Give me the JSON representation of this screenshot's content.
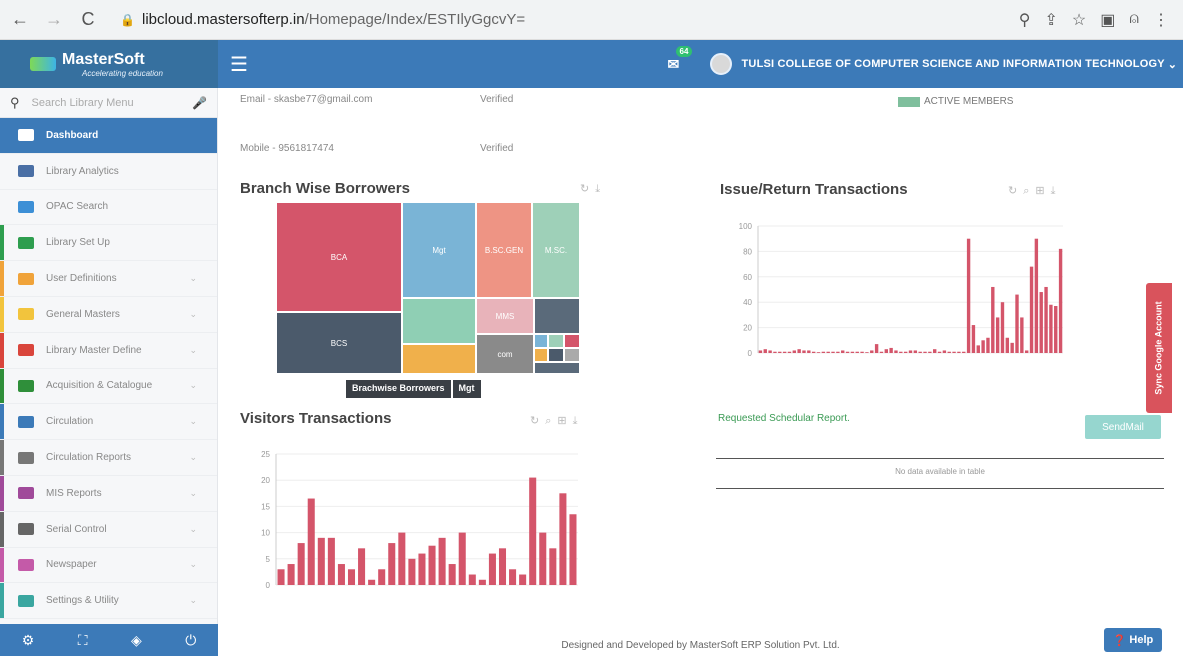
{
  "browser": {
    "url_host": "libcloud.mastersofterp.in",
    "url_path": "/Homepage/Index/ESTIlyGgcvY="
  },
  "topbar": {
    "logo_text": "MasterSoft",
    "logo_tagline": "Accelerating education",
    "notification_count": "64",
    "college_name": "TULSI COLLEGE OF COMPUTER SCIENCE AND INFORMATION TECHNOLOGY"
  },
  "sidebar": {
    "search_placeholder": "Search Library Menu",
    "items": [
      {
        "label": "Dashboard",
        "icon": "home-icon",
        "color": "#3c7ab8"
      },
      {
        "label": "Library Analytics",
        "icon": "bar-chart-icon",
        "color": "#4a6fa5"
      },
      {
        "label": "OPAC Search",
        "icon": "globe-icon",
        "color": "#3c8fd6"
      },
      {
        "label": "Library Set Up",
        "icon": "gears-icon",
        "color": "#2e9e4f"
      },
      {
        "label": "User Definitions",
        "icon": "users-icon",
        "color": "#f0a33a"
      },
      {
        "label": "General Masters",
        "icon": "edit-icon",
        "color": "#f2c43d"
      },
      {
        "label": "Library Master Define",
        "icon": "sitemap-icon",
        "color": "#d9453c"
      },
      {
        "label": "Acquisition & Catalogue",
        "icon": "book-icon",
        "color": "#2f8f3a"
      },
      {
        "label": "Circulation",
        "icon": "refresh-icon",
        "color": "#3c7ab8"
      },
      {
        "label": "Circulation Reports",
        "icon": "area-chart-icon",
        "color": "#777777"
      },
      {
        "label": "MIS Reports",
        "icon": "pie-chart-icon",
        "color": "#a04a9a"
      },
      {
        "label": "Serial Control",
        "icon": "copy-icon",
        "color": "#666666"
      },
      {
        "label": "Newspaper",
        "icon": "newspaper-icon",
        "color": "#c45aa8"
      },
      {
        "label": "Settings & Utility",
        "icon": "settings-icon",
        "color": "#3aa6a0"
      }
    ]
  },
  "profile": {
    "email_label": "Email - skasbe77@gmail.com",
    "email_status": "Verified",
    "mobile_label": "Mobile - 9561817474",
    "mobile_status": "Verified",
    "legend_active": "ACTIVE MEMBERS"
  },
  "panels": {
    "branch_title": "Branch Wise Borrowers",
    "issue_title": "Issue/Return Transactions",
    "visitors_title": "Visitors Transactions",
    "schedular_title": "Requested Schedular Report.",
    "send_button": "SendMail",
    "no_data": "No data available in table"
  },
  "chart_data": [
    {
      "type": "heatmap",
      "title": "Branch Wise Borrowers",
      "tiles": [
        {
          "label": "BCA",
          "value": 34,
          "color": "#d4556a"
        },
        {
          "label": "BCS",
          "value": 22,
          "color": "#4b5a6b"
        },
        {
          "label": "Mgt",
          "value": 14,
          "color": "#7ab4d6"
        },
        {
          "label": "B.SC.GEN",
          "value": 10,
          "color": "#ee9484"
        },
        {
          "label": "M.SC.",
          "value": 9,
          "color": "#9ed0b8"
        },
        {
          "label": "",
          "value": 5,
          "color": "#8fcfb4"
        },
        {
          "label": "MMS",
          "value": 4,
          "color": "#e8b3ba"
        },
        {
          "label": "",
          "value": 4,
          "color": "#5a6a7a"
        },
        {
          "label": "",
          "value": 4,
          "color": "#f0b04b"
        },
        {
          "label": "com",
          "value": 3,
          "color": "#8a8a8a"
        }
      ],
      "breadcrumb": [
        "Brachwise Borrowers",
        "Mgt"
      ]
    },
    {
      "type": "bar",
      "title": "Issue/Return Transactions",
      "ylim": [
        0,
        100
      ],
      "yticks": [
        0,
        20,
        40,
        60,
        80,
        100
      ],
      "values": [
        2,
        3,
        2,
        1,
        1,
        1,
        1,
        2,
        3,
        2,
        2,
        1,
        0,
        1,
        1,
        1,
        1,
        2,
        1,
        1,
        1,
        1,
        0,
        2,
        7,
        1,
        3,
        4,
        2,
        1,
        1,
        2,
        2,
        1,
        1,
        1,
        3,
        1,
        2,
        1,
        1,
        1,
        1,
        90,
        22,
        6,
        10,
        12,
        52,
        28,
        40,
        12,
        8,
        46,
        28,
        2,
        68,
        90,
        48,
        52,
        38,
        37,
        82
      ],
      "color": "#d4556a"
    },
    {
      "type": "bar",
      "title": "Visitors Transactions",
      "ylim": [
        0,
        25
      ],
      "yticks": [
        0,
        5,
        10,
        15,
        20,
        25
      ],
      "values": [
        3,
        4,
        8,
        16.5,
        9,
        9,
        4,
        3,
        7,
        1,
        3,
        8,
        10,
        5,
        6,
        7.5,
        9,
        4,
        10,
        2,
        1,
        6,
        7,
        3,
        2,
        20.5,
        10,
        7,
        17.5,
        13.5
      ],
      "color": "#d4556a"
    }
  ],
  "footer": {
    "text": "Designed and Developed by MasterSoft ERP Solution Pvt. Ltd.",
    "help": "Help",
    "sync_tab": "Sync Google Account"
  }
}
